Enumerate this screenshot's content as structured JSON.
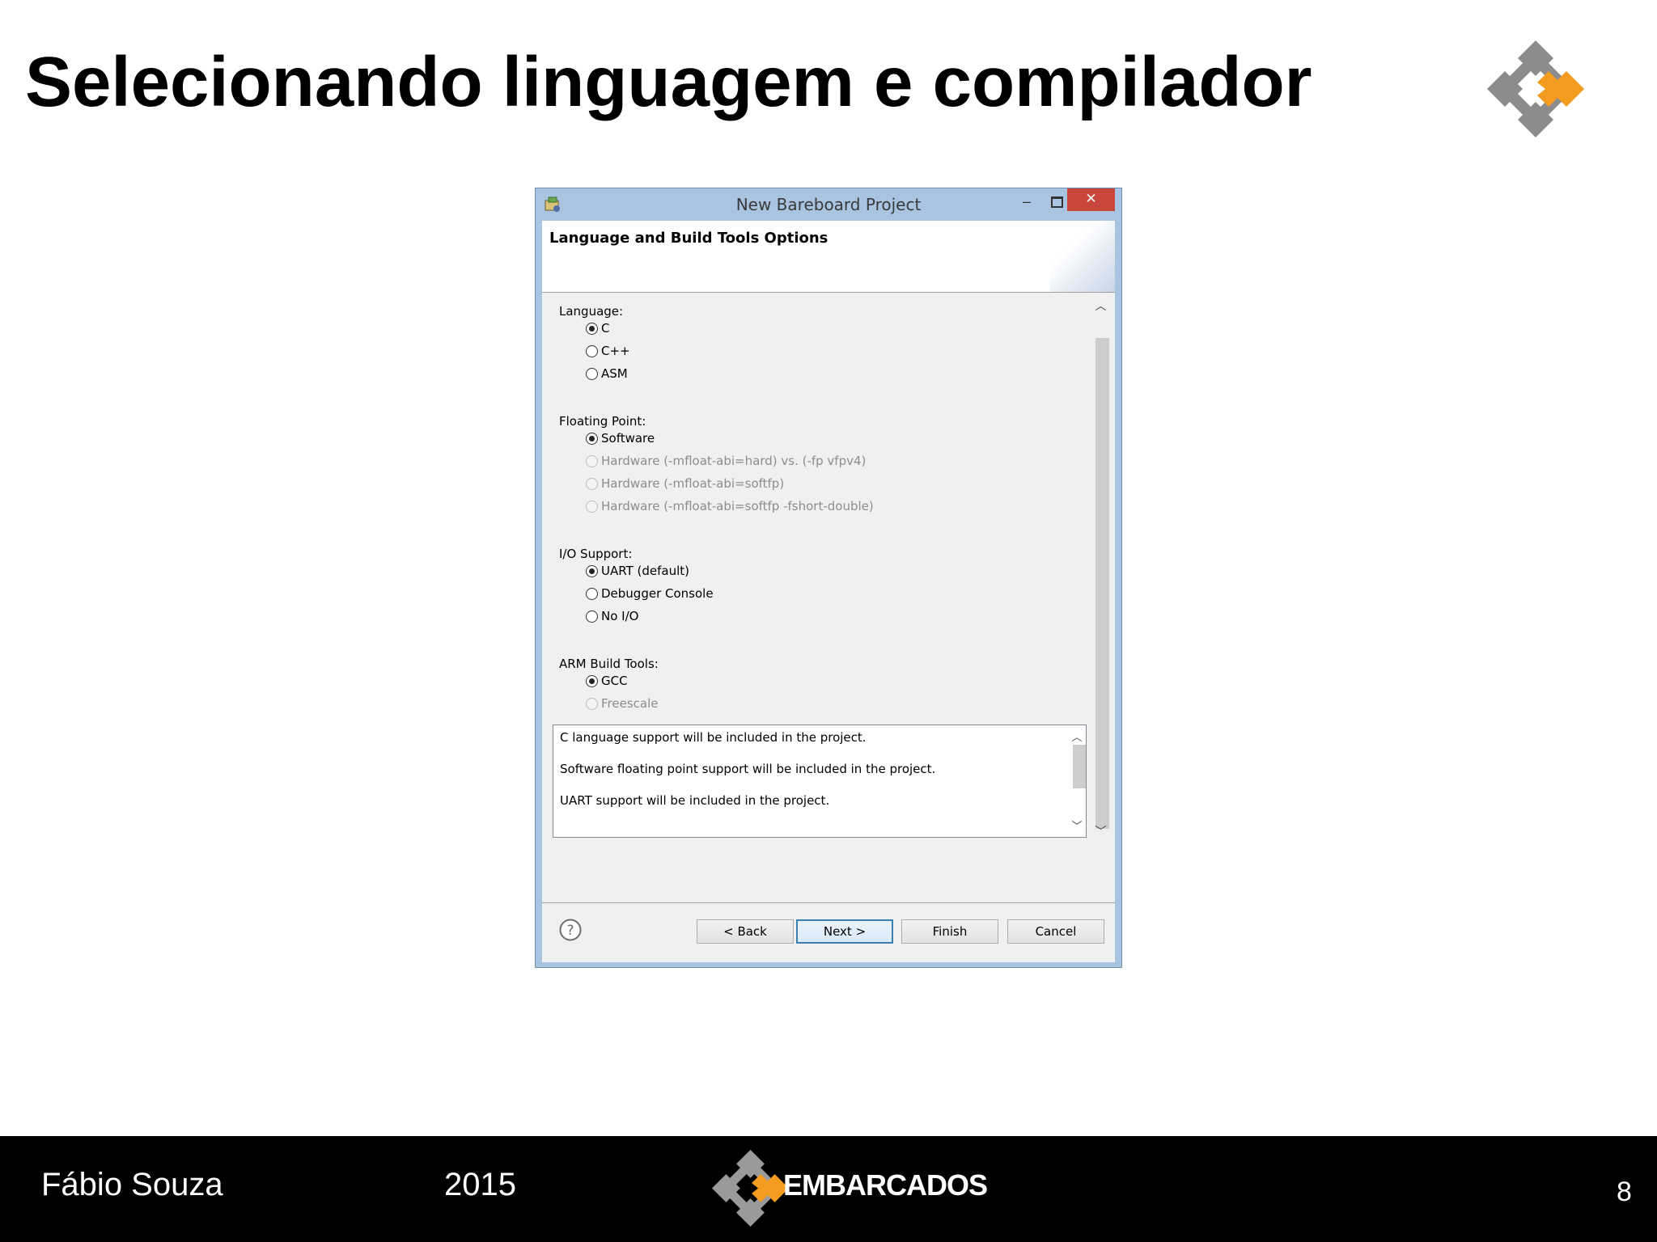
{
  "slide": {
    "title": "Selecionando linguagem e compilador",
    "author": "Fábio Souza",
    "year": "2015",
    "brand": "EMBARCADOS",
    "page_number": "8",
    "logo_colors": {
      "gray": "#8c8c8c",
      "orange": "#f39c1f"
    }
  },
  "dialog": {
    "window_title": "New Bareboard Project",
    "controls": {
      "minimize": "–",
      "close": "✕"
    },
    "header_title": "Language and Build Tools Options",
    "groups": [
      {
        "label": "Language:",
        "options": [
          {
            "label": "C",
            "checked": true,
            "enabled": true
          },
          {
            "label": "C++",
            "checked": false,
            "enabled": true
          },
          {
            "label": "ASM",
            "checked": false,
            "enabled": true
          }
        ]
      },
      {
        "label": "Floating Point:",
        "options": [
          {
            "label": "Software",
            "checked": true,
            "enabled": true
          },
          {
            "label": "Hardware (-mfloat-abi=hard) vs. (-fp vfpv4)",
            "checked": false,
            "enabled": false
          },
          {
            "label": "Hardware (-mfloat-abi=softfp)",
            "checked": false,
            "enabled": false
          },
          {
            "label": "Hardware (-mfloat-abi=softfp -fshort-double)",
            "checked": false,
            "enabled": false
          }
        ]
      },
      {
        "label": "I/O Support:",
        "options": [
          {
            "label": "UART (default)",
            "checked": true,
            "enabled": true
          },
          {
            "label": "Debugger Console",
            "checked": false,
            "enabled": true
          },
          {
            "label": "No I/O",
            "checked": false,
            "enabled": true
          }
        ]
      },
      {
        "label": "ARM Build Tools:",
        "options": [
          {
            "label": "GCC",
            "checked": true,
            "enabled": true
          },
          {
            "label": "Freescale",
            "checked": false,
            "enabled": false
          }
        ]
      }
    ],
    "description_lines": [
      "C language support will be included in the project.",
      "Software floating point support will be included in the project.",
      "UART support will be included in the project."
    ],
    "buttons": {
      "back": "< Back",
      "next": "Next >",
      "finish": "Finish",
      "cancel": "Cancel"
    },
    "help_icon": "question-mark",
    "titlebar_color": "#a9c4e0",
    "close_button_color": "#c9463d"
  }
}
